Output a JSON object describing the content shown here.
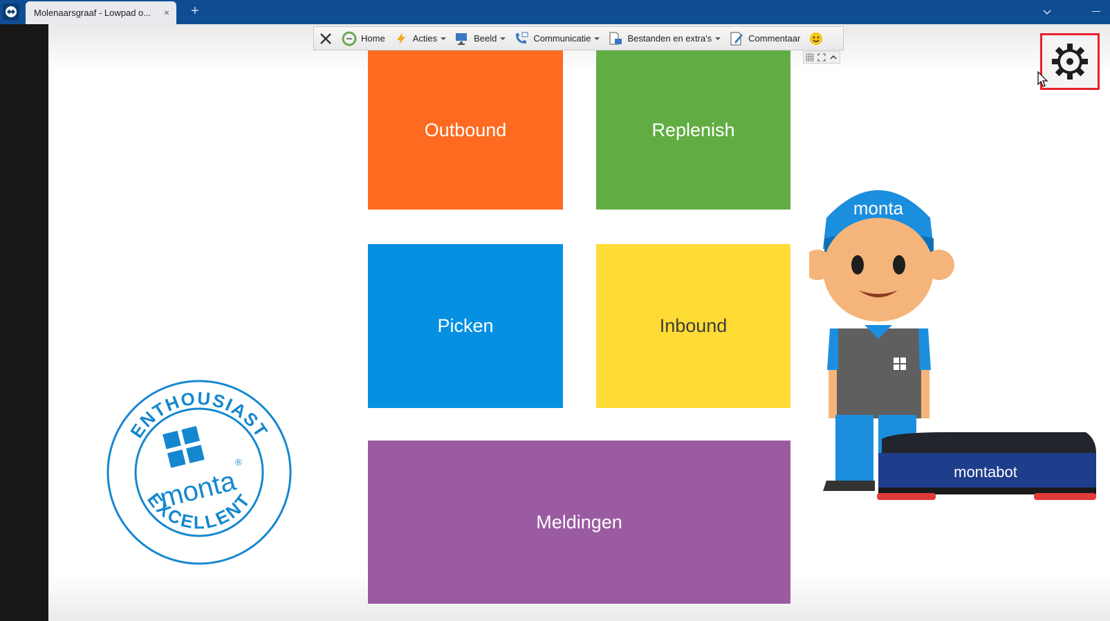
{
  "browser": {
    "tab_title": "Molenaarsgraaf - Lowpad o...",
    "close_glyph": "×",
    "new_tab_glyph": "+"
  },
  "remote_toolbar": {
    "items": [
      {
        "label": "Home",
        "icon": "home-icon"
      },
      {
        "label": "Acties",
        "icon": "lightning-icon",
        "dropdown": true
      },
      {
        "label": "Beeld",
        "icon": "display-icon",
        "dropdown": true
      },
      {
        "label": "Communicatie",
        "icon": "phone-icon",
        "dropdown": true
      },
      {
        "label": "Bestanden en extra's",
        "icon": "file-transfer-icon",
        "dropdown": true
      },
      {
        "label": "Commentaar",
        "icon": "comment-icon"
      }
    ]
  },
  "tiles": {
    "outbound": "Outbound",
    "replenish": "Replenish",
    "picken": "Picken",
    "inbound": "Inbound",
    "meldingen": "Meldingen"
  },
  "stamp": {
    "top_text": "ENTHOUSIAST",
    "brand": "monta",
    "registered": "®",
    "bottom_text": "EXCELLENT"
  },
  "mascot": {
    "cap_text": "monta",
    "robot_text": "montabot"
  },
  "colors": {
    "outbound": "#fe6a1f",
    "replenish": "#61ad44",
    "picken": "#0690e2",
    "inbound": "#ffdb35",
    "meldingen": "#9b5ba1",
    "brand_blue": "#0f4d93",
    "highlight_red": "#e8212b"
  }
}
